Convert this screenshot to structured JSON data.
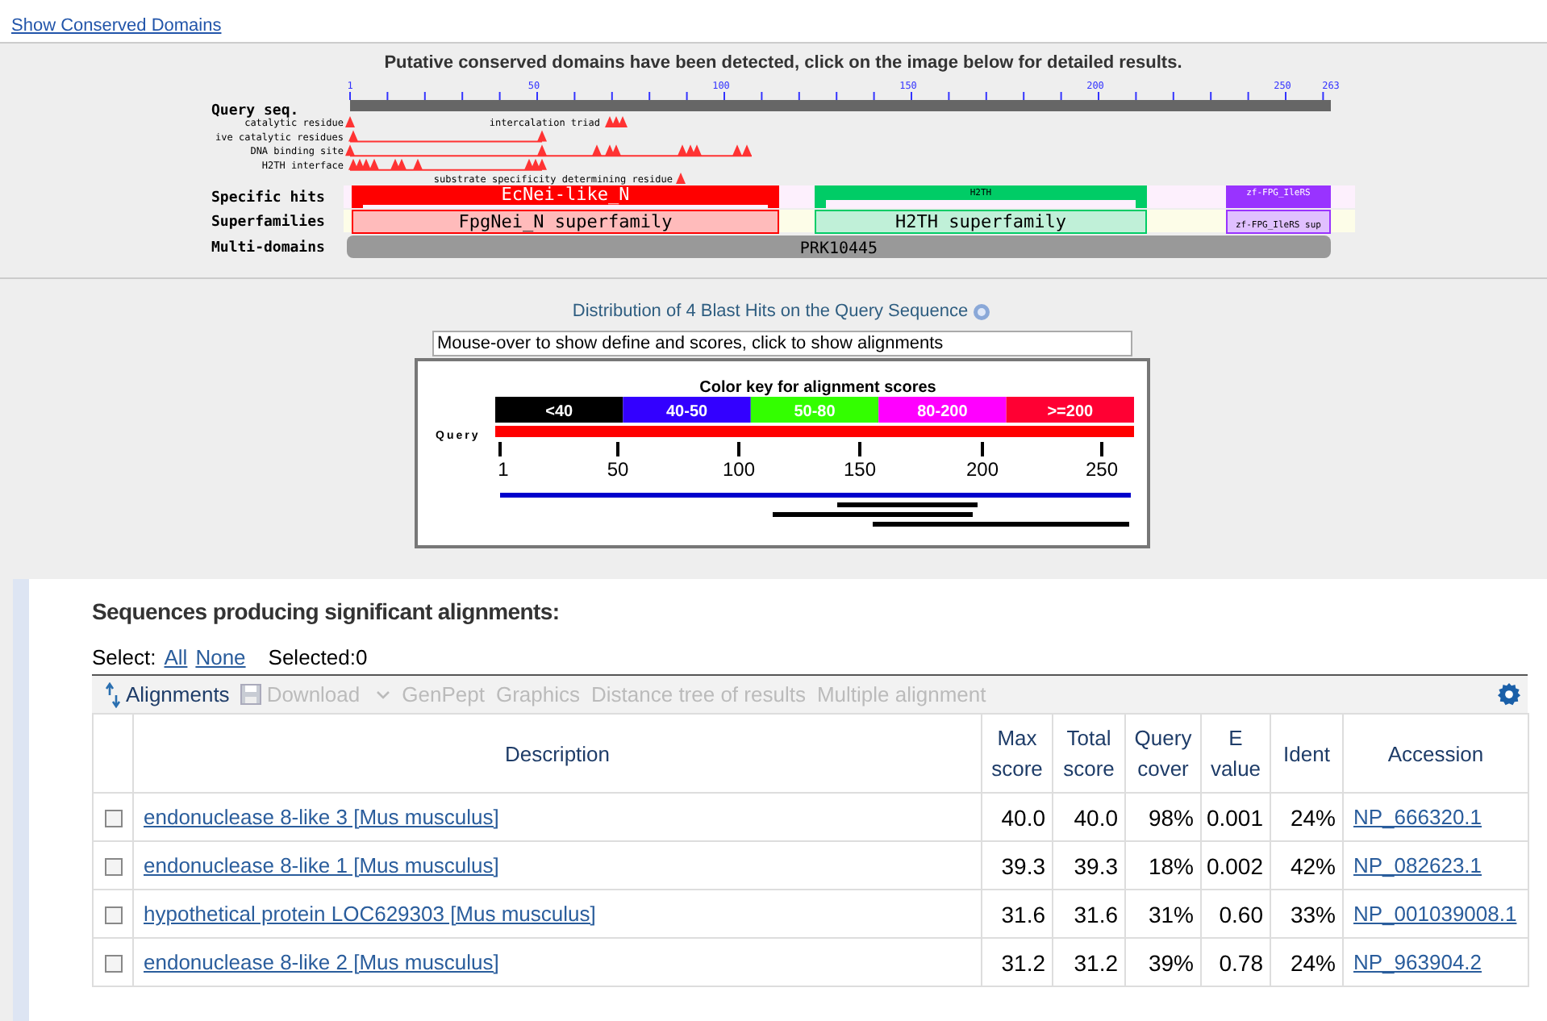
{
  "top_link": "Show Conserved Domains",
  "cdd": {
    "title": "Putative conserved domains have been detected, click on the image below for detailed results.",
    "ruler_labels": [
      "1",
      "50",
      "100",
      "150",
      "200",
      "250",
      "263"
    ],
    "query_label": "Query seq.",
    "features": [
      {
        "label": "catalytic residue"
      },
      {
        "label": "ive catalytic residues"
      },
      {
        "label": "DNA binding site"
      },
      {
        "label": "H2TH interface"
      }
    ],
    "feature_notes": [
      "intercalation triad",
      "substrate specificity determining residue"
    ],
    "tracks": [
      {
        "label": "Specific hits",
        "domains": [
          {
            "name": "EcNei-like_N",
            "color": "#ff0000"
          },
          {
            "name": "H2TH",
            "color": "#00cc66"
          },
          {
            "name": "zf-FPG_IleRS",
            "color": "#9933ff"
          }
        ]
      },
      {
        "label": "Superfamilies",
        "domains": [
          {
            "name": "FpgNei_N superfamily",
            "color": "#ff0000"
          },
          {
            "name": "H2TH superfamily",
            "color": "#00cc66"
          },
          {
            "name": "zf-FPG_IleRS sup",
            "color": "#9933ff"
          }
        ]
      },
      {
        "label": "Multi-domains",
        "domains": [
          {
            "name": "PRK10445",
            "color": "#999999"
          }
        ]
      }
    ]
  },
  "blast": {
    "title": "Distribution of 4 Blast Hits on the Query Sequence",
    "hint": "Mouse-over to show define and scores, click to show alignments",
    "key_title": "Color key for alignment scores",
    "key": [
      {
        "label": "<40",
        "color": "#000000"
      },
      {
        "label": "40-50",
        "color": "#3300ff"
      },
      {
        "label": "50-80",
        "color": "#33ff00"
      },
      {
        "label": "80-200",
        "color": "#ff00ff"
      },
      {
        "label": ">=200",
        "color": "#ff0033"
      }
    ],
    "query_label": "Query",
    "ticks": [
      "1",
      "50",
      "100",
      "150",
      "200",
      "250"
    ],
    "hits": [
      {
        "color": "#0000cc"
      },
      {
        "color": "#000000"
      },
      {
        "color": "#000000"
      },
      {
        "color": "#000000"
      }
    ]
  },
  "results": {
    "title": "Sequences producing significant alignments:",
    "select_label": "Select:",
    "select_all": "All",
    "select_none": "None",
    "selected": "Selected:0",
    "toolbar": [
      {
        "label": "Alignments",
        "kind": "sort",
        "disabled": false
      },
      {
        "label": "Download",
        "kind": "download",
        "disabled": true
      },
      {
        "label": "GenPept",
        "kind": "link",
        "disabled": true
      },
      {
        "label": "Graphics",
        "kind": "link",
        "disabled": true
      },
      {
        "label": "Distance tree of results",
        "kind": "link",
        "disabled": true
      },
      {
        "label": "Multiple alignment",
        "kind": "link",
        "disabled": true
      }
    ],
    "columns": [
      "Description",
      "Max score",
      "Total score",
      "Query cover",
      "E value",
      "Ident",
      "Accession"
    ],
    "rows": [
      {
        "checked": false,
        "cells": [
          "endonuclease 8-like 3 [Mus musculus]",
          "40.0",
          "40.0",
          "98%",
          "0.001",
          "24%",
          "NP_666320.1"
        ]
      },
      {
        "checked": false,
        "cells": [
          "endonuclease 8-like 1 [Mus musculus]",
          "39.3",
          "39.3",
          "18%",
          "0.002",
          "42%",
          "NP_082623.1"
        ]
      },
      {
        "checked": false,
        "cells": [
          "hypothetical protein LOC629303 [Mus musculus]",
          "31.6",
          "31.6",
          "31%",
          "0.60",
          "33%",
          "NP_001039008.1"
        ]
      },
      {
        "checked": false,
        "cells": [
          "endonuclease 8-like 2 [Mus musculus]",
          "31.2",
          "31.2",
          "39%",
          "0.78",
          "24%",
          "NP_963904.2"
        ]
      }
    ]
  }
}
